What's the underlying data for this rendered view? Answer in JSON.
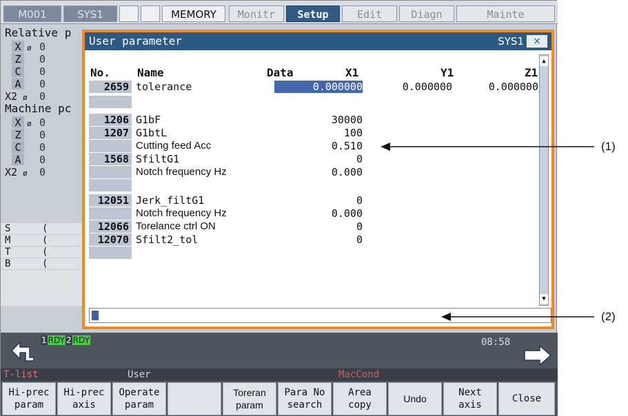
{
  "topbar": {
    "tabs": [
      {
        "label": "M001"
      },
      {
        "label": "SYS1"
      },
      {
        "label": ""
      },
      {
        "label": ""
      },
      {
        "label": "MEMORY"
      },
      {
        "label": "Monitr"
      },
      {
        "label": "Setup"
      },
      {
        "label": "Edit"
      },
      {
        "label": "Diagn"
      },
      {
        "label": "Mainte"
      }
    ]
  },
  "background": {
    "relative_head": "Relative p",
    "machine_head": "Machine pc",
    "relative_axes": [
      {
        "axis": "X",
        "sub": "ø",
        "val": "0"
      },
      {
        "axis": "Z",
        "sub": "",
        "val": "0"
      },
      {
        "axis": "C",
        "sub": "",
        "val": "0"
      },
      {
        "axis": "A",
        "sub": "",
        "val": "0"
      },
      {
        "axis": "X2",
        "sub": "ø",
        "val": "0"
      }
    ],
    "machine_axes": [
      {
        "axis": "X",
        "sub": "ø",
        "val": "0"
      },
      {
        "axis": "Z",
        "sub": "",
        "val": "0"
      },
      {
        "axis": "C",
        "sub": "",
        "val": "0"
      },
      {
        "axis": "A",
        "sub": "",
        "val": "0"
      },
      {
        "axis": "X2",
        "sub": "ø",
        "val": "0"
      }
    ],
    "spindle": [
      {
        "k": "S",
        "v": "("
      },
      {
        "k": "M",
        "v": "("
      },
      {
        "k": "T",
        "v": "("
      },
      {
        "k": "B",
        "v": "("
      }
    ]
  },
  "dialog": {
    "title": "User parameter",
    "system": "SYS1",
    "close": "×",
    "headers": {
      "no": "No.",
      "name": "Name",
      "data": "Data",
      "x1": "X1",
      "y1": "Y1",
      "z1": "Z1"
    },
    "rows": [
      {
        "no": "2659",
        "name": "tolerance",
        "x1": "0.000000",
        "y1": "0.000000",
        "z1": "0.000000"
      },
      {
        "no": "1206",
        "name": "G1bF",
        "x1": "30000"
      },
      {
        "no": "1207",
        "name": "G1btL",
        "x1": "100"
      },
      {
        "no": "",
        "name": "Cutting feed Acc",
        "x1": "0.510"
      },
      {
        "no": "1568",
        "name": "SfiltG1",
        "x1": "0"
      },
      {
        "no": "",
        "name": "Notch frequency Hz",
        "x1": "0.000"
      },
      {
        "no": "12051",
        "name": "Jerk_filtG1",
        "x1": "0"
      },
      {
        "no": "",
        "name": "Notch frequency Hz",
        "x1": "0.000"
      },
      {
        "no": "12066",
        "name": "Torelance ctrl ON",
        "x1": "0"
      },
      {
        "no": "12070",
        "name": "Sfilt2_tol",
        "x1": "0"
      }
    ],
    "input_value": ""
  },
  "status": {
    "rdy1_num": "1",
    "rdy1_text": "RDY",
    "rdy2_num": "2",
    "rdy2_text": "RDY",
    "clock": "08:58"
  },
  "menu_labels": {
    "tlist": "T-list",
    "user": "User",
    "maccond": "MacCond"
  },
  "softkeys": [
    "Hi-prec\nparam",
    "Hi-prec\naxis",
    "Operate\nparam",
    "",
    "Toreran\nparam",
    "Para No\nsearch",
    "Area\ncopy",
    "Undo",
    "Next\naxis",
    "Close"
  ],
  "callouts": {
    "one": "(1)",
    "two": "(2)"
  }
}
